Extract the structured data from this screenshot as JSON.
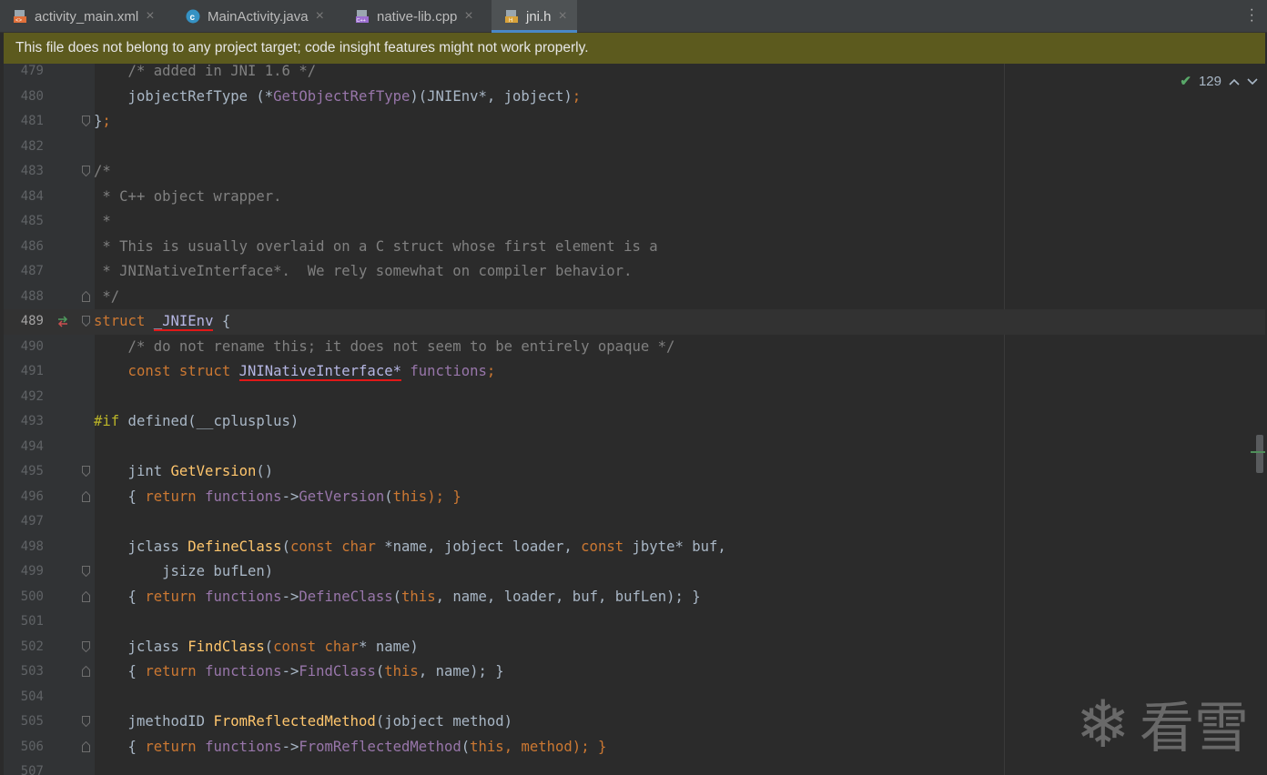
{
  "tabs": [
    {
      "label": "activity_main.xml",
      "icon": "xml-file-icon",
      "active": false
    },
    {
      "label": "MainActivity.java",
      "icon": "java-class-icon",
      "active": false
    },
    {
      "label": "native-lib.cpp",
      "icon": "cpp-file-icon",
      "active": false
    },
    {
      "label": "jni.h",
      "icon": "header-file-icon",
      "active": true
    }
  ],
  "tab_close": "×",
  "banner": {
    "text": "This file does not belong to any project target; code insight features might not work properly."
  },
  "inspection": {
    "count": "129",
    "check": "✔",
    "up": "^",
    "down": "v"
  },
  "current_line": "489",
  "lines": [
    {
      "n": "479"
    },
    {
      "n": "480"
    },
    {
      "n": "481"
    },
    {
      "n": "482"
    },
    {
      "n": "483"
    },
    {
      "n": "484"
    },
    {
      "n": "485"
    },
    {
      "n": "486"
    },
    {
      "n": "487"
    },
    {
      "n": "488"
    },
    {
      "n": "489"
    },
    {
      "n": "490"
    },
    {
      "n": "491"
    },
    {
      "n": "492"
    },
    {
      "n": "493"
    },
    {
      "n": "494"
    },
    {
      "n": "495"
    },
    {
      "n": "496"
    },
    {
      "n": "497"
    },
    {
      "n": "498"
    },
    {
      "n": "499"
    },
    {
      "n": "500"
    },
    {
      "n": "501"
    },
    {
      "n": "502"
    },
    {
      "n": "503"
    },
    {
      "n": "504"
    },
    {
      "n": "505"
    },
    {
      "n": "506"
    },
    {
      "n": "507"
    }
  ],
  "code": {
    "l479": "    /* added in JNI 1.6 */",
    "l480_a": "    jobjectRefType (*",
    "l480_b": "GetObjectRefType",
    "l480_c": ")(JNIEnv*, jobject)",
    "l480_d": ";",
    "l481_a": "}",
    "l481_b": ";",
    "l483": "/*",
    "l484": " * C++ object wrapper.",
    "l485": " *",
    "l486": " * This is usually overlaid on a C struct whose first element is a",
    "l487": " * JNINativeInterface*.  We rely somewhat on compiler behavior.",
    "l488": " */",
    "l489_kw": "struct",
    "l489_name": "_JNIEnv",
    "l489_brace": " {",
    "l490": "    /* do not rename this; it does not seem to be entirely opaque */",
    "l491_kw": "    const struct ",
    "l491_type": "JNINativeInterface*",
    "l491_field": "functions",
    "l491_semi": ";",
    "l493_pp": "#if",
    "l493_rest": " defined(__cplusplus)",
    "l495_type": "    jint ",
    "l495_fn": "GetVersion",
    "l495_rest": "()",
    "l496_a": "    { ",
    "l496_kw": "return",
    "l496_pu": " functions",
    "l496_arrow": "->",
    "l496_call": "GetVersion",
    "l496_p": "(",
    "l496_this": "this",
    "l496_end": "); }",
    "l498_type": "    jclass ",
    "l498_fn": "DefineClass",
    "l498_p": "(",
    "l498_k1": "const char ",
    "l498_r1": "*name, jobject loader, ",
    "l498_k2": "const ",
    "l498_r2": "jbyte* buf,",
    "l499": "        jsize bufLen)",
    "l500_a": "    { ",
    "l500_kw": "return",
    "l500_pu": " functions",
    "l500_arrow": "->",
    "l500_call": "DefineClass",
    "l500_p": "(",
    "l500_this": "this",
    "l500_end": ", name, loader, buf, bufLen); }",
    "l502_type": "    jclass ",
    "l502_fn": "FindClass",
    "l502_p": "(",
    "l502_k": "const char",
    "l502_rest": "* name)",
    "l503_a": "    { ",
    "l503_kw": "return",
    "l503_pu": " functions",
    "l503_arrow": "->",
    "l503_call": "FindClass",
    "l503_p": "(",
    "l503_this": "this",
    "l503_end": ", name); }",
    "l505_type": "    jmethodID ",
    "l505_fn": "FromReflectedMethod",
    "l505_rest": "(jobject method)",
    "l506_a": "    { ",
    "l506_kw": "return",
    "l506_pu": " functions",
    "l506_arrow": "->",
    "l506_call": "FromReflectedMethod",
    "l506_p": "(",
    "l506_this": "this",
    "l506_end": ", method); }"
  },
  "watermark": {
    "glyph": "❄",
    "text": "看雪"
  },
  "colors": {
    "keyword": "#cc7832",
    "comment": "#808080",
    "function": "#ffc66d",
    "preprocessor": "#bbb529",
    "member": "#9876aa",
    "underline": "#e01818",
    "banner": "#5c5a1e",
    "active_tab_indicator": "#4a88c7"
  }
}
